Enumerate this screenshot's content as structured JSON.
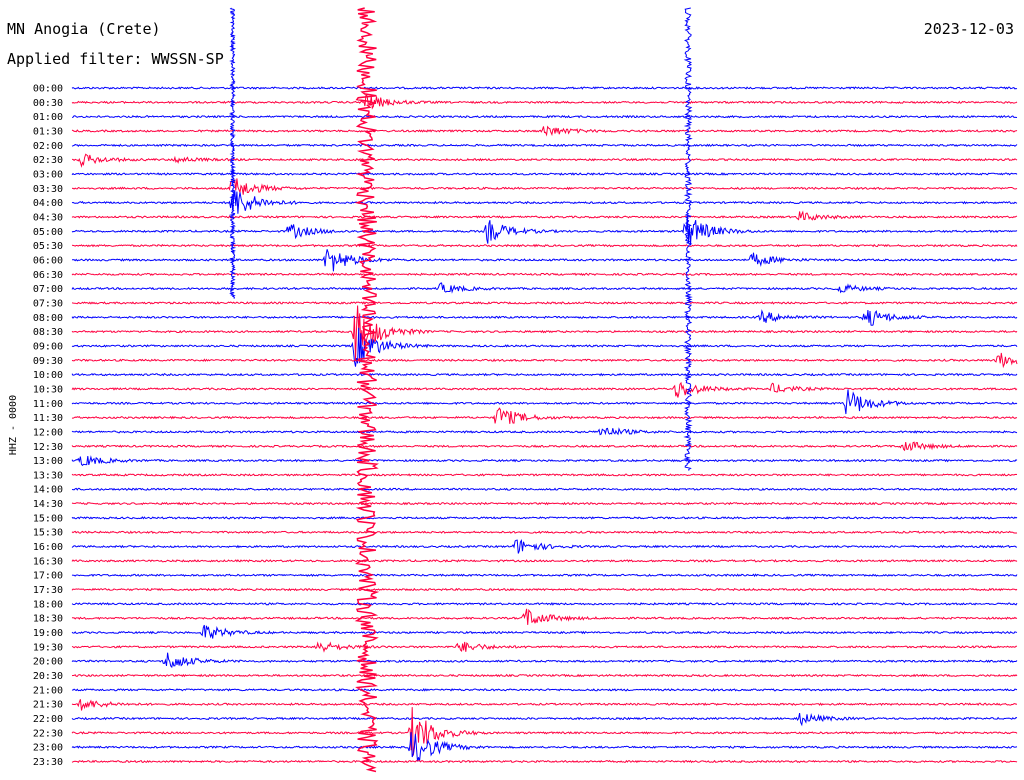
{
  "chart_data": {
    "type": "line",
    "title": "MN Anogia (Crete)",
    "subtitle": "Applied filter: WWSSN-SP",
    "date": "2023-12-03",
    "ylabel": "HHZ - 0000",
    "colors": [
      "#0000ff",
      "#ff0040"
    ],
    "rows": [
      "00:00",
      "00:30",
      "01:00",
      "01:30",
      "02:00",
      "02:30",
      "03:00",
      "03:30",
      "04:00",
      "04:30",
      "05:00",
      "05:30",
      "06:00",
      "06:30",
      "07:00",
      "07:30",
      "08:00",
      "08:30",
      "09:00",
      "09:30",
      "10:00",
      "10:30",
      "11:00",
      "11:30",
      "12:00",
      "12:30",
      "13:00",
      "13:30",
      "14:00",
      "14:30",
      "15:00",
      "15:30",
      "16:00",
      "16:30",
      "17:00",
      "17:30",
      "18:00",
      "18:30",
      "19:00",
      "19:30",
      "20:00",
      "20:30",
      "21:00",
      "21:30",
      "22:00",
      "22:30",
      "23:00",
      "23:30"
    ],
    "events": [
      {
        "row": 1,
        "t": 0.31,
        "amp": 9
      },
      {
        "row": 3,
        "t": 0.5,
        "amp": 6
      },
      {
        "row": 5,
        "t": 0.01,
        "amp": 6
      },
      {
        "row": 5,
        "t": 0.11,
        "amp": 3
      },
      {
        "row": 7,
        "t": 0.17,
        "amp": 12
      },
      {
        "row": 8,
        "t": 0.17,
        "amp": 18
      },
      {
        "row": 9,
        "t": 0.77,
        "amp": 5
      },
      {
        "row": 10,
        "t": 0.44,
        "amp": 12
      },
      {
        "row": 10,
        "t": 0.65,
        "amp": 18
      },
      {
        "row": 10,
        "t": 0.23,
        "amp": 8
      },
      {
        "row": 12,
        "t": 0.27,
        "amp": 15
      },
      {
        "row": 12,
        "t": 0.72,
        "amp": 7
      },
      {
        "row": 14,
        "t": 0.39,
        "amp": 5
      },
      {
        "row": 14,
        "t": 0.81,
        "amp": 5
      },
      {
        "row": 16,
        "t": 0.73,
        "amp": 6
      },
      {
        "row": 16,
        "t": 0.84,
        "amp": 10
      },
      {
        "row": 17,
        "t": 0.3,
        "amp": 30
      },
      {
        "row": 18,
        "t": 0.3,
        "amp": 22
      },
      {
        "row": 19,
        "t": 0.98,
        "amp": 8
      },
      {
        "row": 21,
        "t": 0.64,
        "amp": 10
      },
      {
        "row": 21,
        "t": 0.74,
        "amp": 5
      },
      {
        "row": 22,
        "t": 0.82,
        "amp": 15
      },
      {
        "row": 23,
        "t": 0.45,
        "amp": 12
      },
      {
        "row": 24,
        "t": 0.56,
        "amp": 6
      },
      {
        "row": 25,
        "t": 0.88,
        "amp": 6
      },
      {
        "row": 26,
        "t": 0.01,
        "amp": 6
      },
      {
        "row": 32,
        "t": 0.47,
        "amp": 8
      },
      {
        "row": 37,
        "t": 0.48,
        "amp": 10
      },
      {
        "row": 38,
        "t": 0.14,
        "amp": 8
      },
      {
        "row": 39,
        "t": 0.26,
        "amp": 6
      },
      {
        "row": 39,
        "t": 0.41,
        "amp": 6
      },
      {
        "row": 40,
        "t": 0.1,
        "amp": 10
      },
      {
        "row": 43,
        "t": 0.01,
        "amp": 6
      },
      {
        "row": 44,
        "t": 0.77,
        "amp": 6
      },
      {
        "row": 45,
        "t": 0.36,
        "amp": 25
      },
      {
        "row": 46,
        "t": 0.36,
        "amp": 20
      }
    ],
    "spikes": [
      {
        "t": 0.312,
        "rowFrom": 0,
        "rowTo": 47,
        "amp": 10
      },
      {
        "t": 0.652,
        "rowFrom": 0,
        "rowTo": 26,
        "amp": 3
      },
      {
        "t": 0.17,
        "rowFrom": 0,
        "rowTo": 14,
        "amp": 2
      }
    ]
  }
}
